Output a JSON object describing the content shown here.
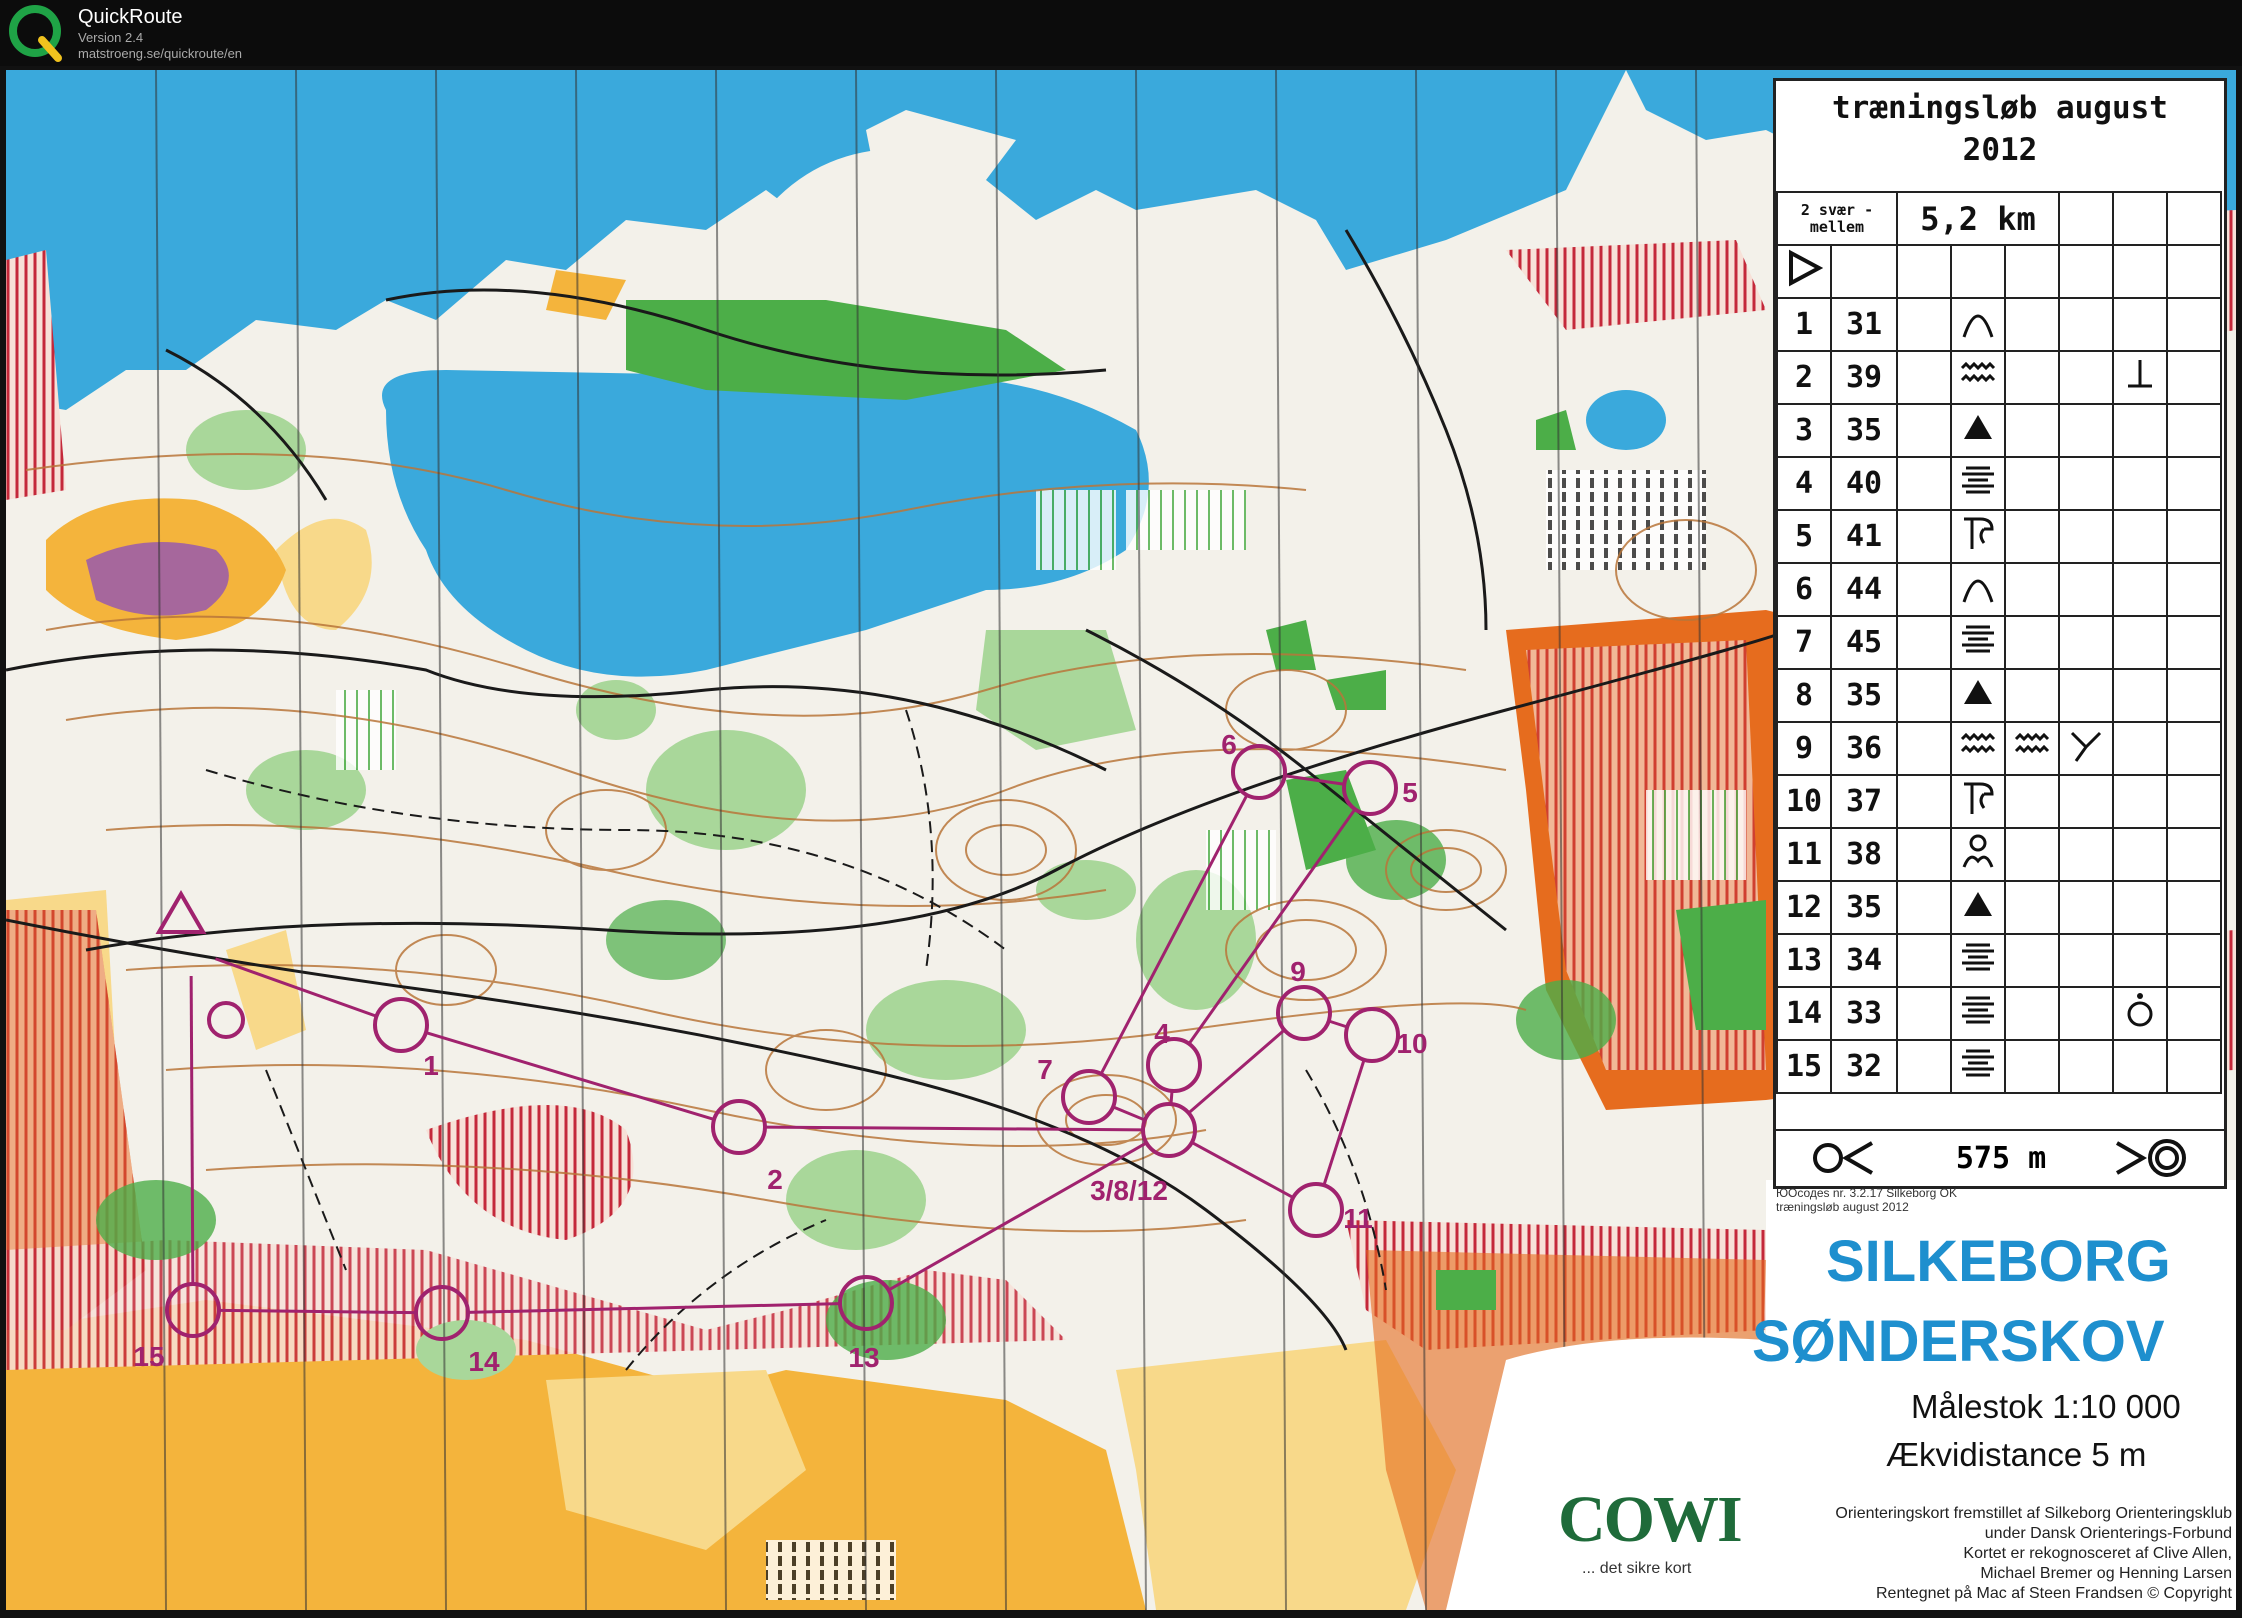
{
  "app": {
    "name": "QuickRoute",
    "version": "Version 2.4",
    "url": "matstroeng.se/quickroute/en",
    "logo_letter": "Q"
  },
  "colors": {
    "water": "#3aa9dc",
    "open_land": "#f4b43c",
    "rough_open": "#f8d98a",
    "forest_green": "#4cae48",
    "light_green": "#a9d79a",
    "course": "#a0226e",
    "title_blue": "#1e8fce",
    "settlement": "#e66c1e"
  },
  "course": {
    "controls": [
      {
        "label": "1"
      },
      {
        "label": "2"
      },
      {
        "label": "3/8/12"
      },
      {
        "label": "4"
      },
      {
        "label": "5"
      },
      {
        "label": "6"
      },
      {
        "label": "7"
      },
      {
        "label": "9"
      },
      {
        "label": "10"
      },
      {
        "label": "11"
      },
      {
        "label": "13"
      },
      {
        "label": "14"
      },
      {
        "label": "15"
      }
    ]
  },
  "description_sheet": {
    "title_line1": "træningsløb august",
    "title_line2": "2012",
    "class_line1": "2 svær -",
    "class_line2": "mellem",
    "length": "5,2 km",
    "rows": [
      {
        "num": "1",
        "code": "31",
        "symbol": "knoll-symbol",
        "extra": ""
      },
      {
        "num": "2",
        "code": "39",
        "symbol": "ditch-symbol",
        "extra": "foot-symbol"
      },
      {
        "num": "3",
        "code": "35",
        "symbol": "boulder-symbol",
        "extra": ""
      },
      {
        "num": "4",
        "code": "40",
        "symbol": "terrace-symbol",
        "extra": ""
      },
      {
        "num": "5",
        "code": "41",
        "symbol": "re-entrant-symbol",
        "extra": ""
      },
      {
        "num": "6",
        "code": "44",
        "symbol": "knoll-symbol",
        "extra": ""
      },
      {
        "num": "7",
        "code": "45",
        "symbol": "terrace-symbol",
        "extra": ""
      },
      {
        "num": "8",
        "code": "35",
        "symbol": "boulder-symbol",
        "extra": ""
      },
      {
        "num": "9",
        "code": "36",
        "symbol": "ditch-symbol",
        "extra": "ditch-junction-symbol"
      },
      {
        "num": "10",
        "code": "37",
        "symbol": "re-entrant-symbol",
        "extra": ""
      },
      {
        "num": "11",
        "code": "38",
        "symbol": "knolls-symbol",
        "extra": ""
      },
      {
        "num": "12",
        "code": "35",
        "symbol": "boulder-symbol",
        "extra": ""
      },
      {
        "num": "13",
        "code": "34",
        "symbol": "terrace-symbol",
        "extra": ""
      },
      {
        "num": "14",
        "code": "33",
        "symbol": "terrace-symbol",
        "extra": "top-symbol"
      },
      {
        "num": "15",
        "code": "32",
        "symbol": "terrace-symbol",
        "extra": ""
      }
    ],
    "finish_distance": "575 m"
  },
  "map_info": {
    "credit_line1": "ЮОсодеs  nr.  3.2.17  Silkeborg OK",
    "credit_line2": "træningsløb august 2012",
    "title_line1": "SILKEBORG",
    "title_line2": "SØNDERSKOV",
    "scale": "Målestok 1:10 000",
    "contour": "Ækvidistance 5 m",
    "publisher_logo": "COWI",
    "publisher_tagline": "... det sikre kort",
    "club_credit_1": "Orienteringskort fremstillet af Silkeborg Orienteringsklub",
    "club_credit_2": "under Dansk Orienterings-Forbund",
    "club_credit_3": "Kortet er rekognosceret af Clive Allen,",
    "club_credit_4": "Michael Bremer og Henning Larsen",
    "club_credit_5": "Rentegnet på Mac af Steen Frandsen   © Copyright"
  }
}
